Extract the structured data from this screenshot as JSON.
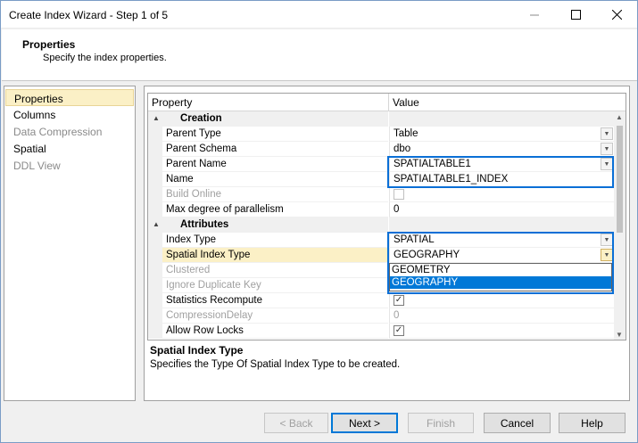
{
  "window": {
    "title": "Create Index Wizard - Step 1 of 5"
  },
  "header": {
    "title": "Properties",
    "subtitle": "Specify the index properties."
  },
  "sidebar": {
    "items": [
      {
        "label": "Properties",
        "state": "selected"
      },
      {
        "label": "Columns",
        "state": "enabled"
      },
      {
        "label": "Data Compression",
        "state": "disabled"
      },
      {
        "label": "Spatial",
        "state": "enabled"
      },
      {
        "label": "DDL View",
        "state": "disabled"
      }
    ]
  },
  "grid": {
    "columns": [
      "Property",
      "Value"
    ],
    "categories": {
      "creation": "Creation",
      "attributes": "Attributes"
    },
    "rows": {
      "parent_type": {
        "name": "Parent Type",
        "value": "Table"
      },
      "parent_schema": {
        "name": "Parent Schema",
        "value": "dbo"
      },
      "parent_name": {
        "name": "Parent Name",
        "value": "SPATIALTABLE1"
      },
      "name": {
        "name": "Name",
        "value": "SPATIALTABLE1_INDEX"
      },
      "build_online": {
        "name": "Build Online",
        "value": ""
      },
      "max_dop": {
        "name": "Max degree of parallelism",
        "value": "0"
      },
      "index_type": {
        "name": "Index Type",
        "value": "SPATIAL"
      },
      "spatial_index_type": {
        "name": "Spatial Index Type",
        "value": "GEOGRAPHY"
      },
      "clustered": {
        "name": "Clustered",
        "value": ""
      },
      "ignore_dup_key": {
        "name": "Ignore Duplicate Key",
        "value": ""
      },
      "stats_recompute": {
        "name": "Statistics Recompute",
        "value": ""
      },
      "compression_delay": {
        "name": "CompressionDelay",
        "value": "0"
      },
      "allow_row_locks": {
        "name": "Allow Row Locks",
        "value": ""
      }
    },
    "dropdown_options": [
      "GEOMETRY",
      "GEOGRAPHY"
    ],
    "dropdown_selected": "GEOGRAPHY"
  },
  "description": {
    "title": "Spatial Index Type",
    "text": "Specifies the Type Of Spatial Index Type to be created."
  },
  "buttons": {
    "back": "< Back",
    "next": "Next >",
    "finish": "Finish",
    "cancel": "Cancel",
    "help": "Help"
  },
  "icons": {
    "minimize": "minimize-icon",
    "maximize": "maximize-icon",
    "close": "close-icon",
    "collapse": "collapse-triangle-icon",
    "dropdown": "chevron-down-icon",
    "checkbox": "checkmark-icon"
  },
  "colors": {
    "accent": "#0078d7",
    "highlight_border": "#0a6fd6",
    "selection_bg": "#fbf0c6"
  }
}
